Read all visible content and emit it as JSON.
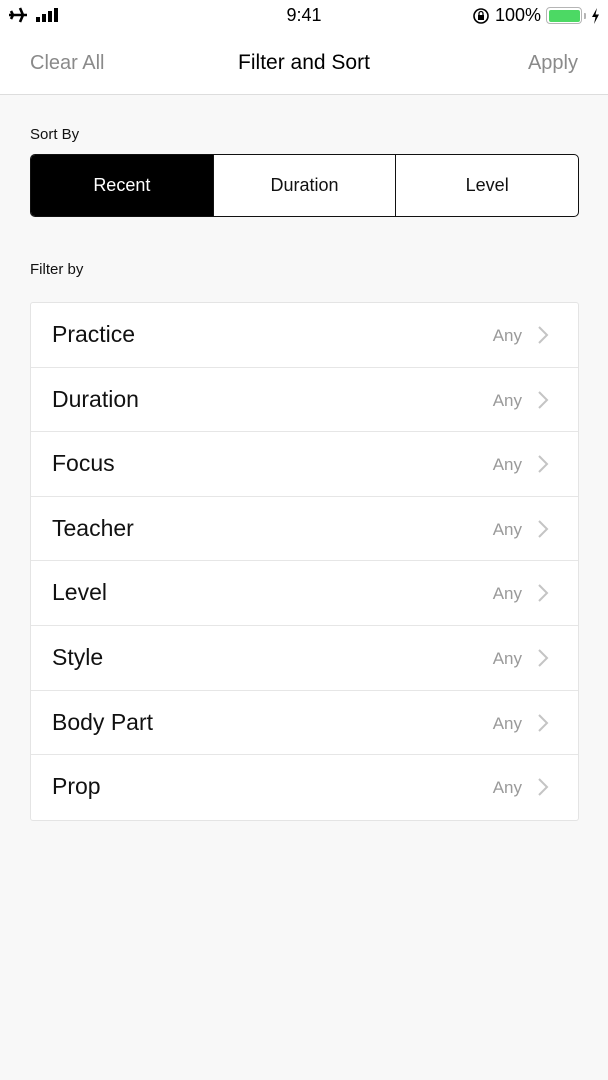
{
  "status_bar": {
    "time": "9:41",
    "battery_percent": "100%",
    "battery_level": 1.0,
    "icons": {
      "airplane": "airplane-icon",
      "signal": "signal-icon",
      "orientation_lock": "orientation-lock-icon",
      "battery": "battery-icon",
      "charging": "charging-bolt-icon"
    }
  },
  "nav": {
    "left_label": "Clear All",
    "title": "Filter and Sort",
    "right_label": "Apply"
  },
  "sort": {
    "label": "Sort By",
    "options": [
      {
        "label": "Recent",
        "selected": true
      },
      {
        "label": "Duration",
        "selected": false
      },
      {
        "label": "Level",
        "selected": false
      }
    ]
  },
  "filter": {
    "label": "Filter by",
    "items": [
      {
        "label": "Practice",
        "value": "Any"
      },
      {
        "label": "Duration",
        "value": "Any"
      },
      {
        "label": "Focus",
        "value": "Any"
      },
      {
        "label": "Teacher",
        "value": "Any"
      },
      {
        "label": "Level",
        "value": "Any"
      },
      {
        "label": "Style",
        "value": "Any"
      },
      {
        "label": "Body Part",
        "value": "Any"
      },
      {
        "label": "Prop",
        "value": "Any"
      }
    ]
  },
  "colors": {
    "accent": "#000000",
    "muted_text": "#8a8a8a",
    "battery_green": "#4cd964"
  }
}
